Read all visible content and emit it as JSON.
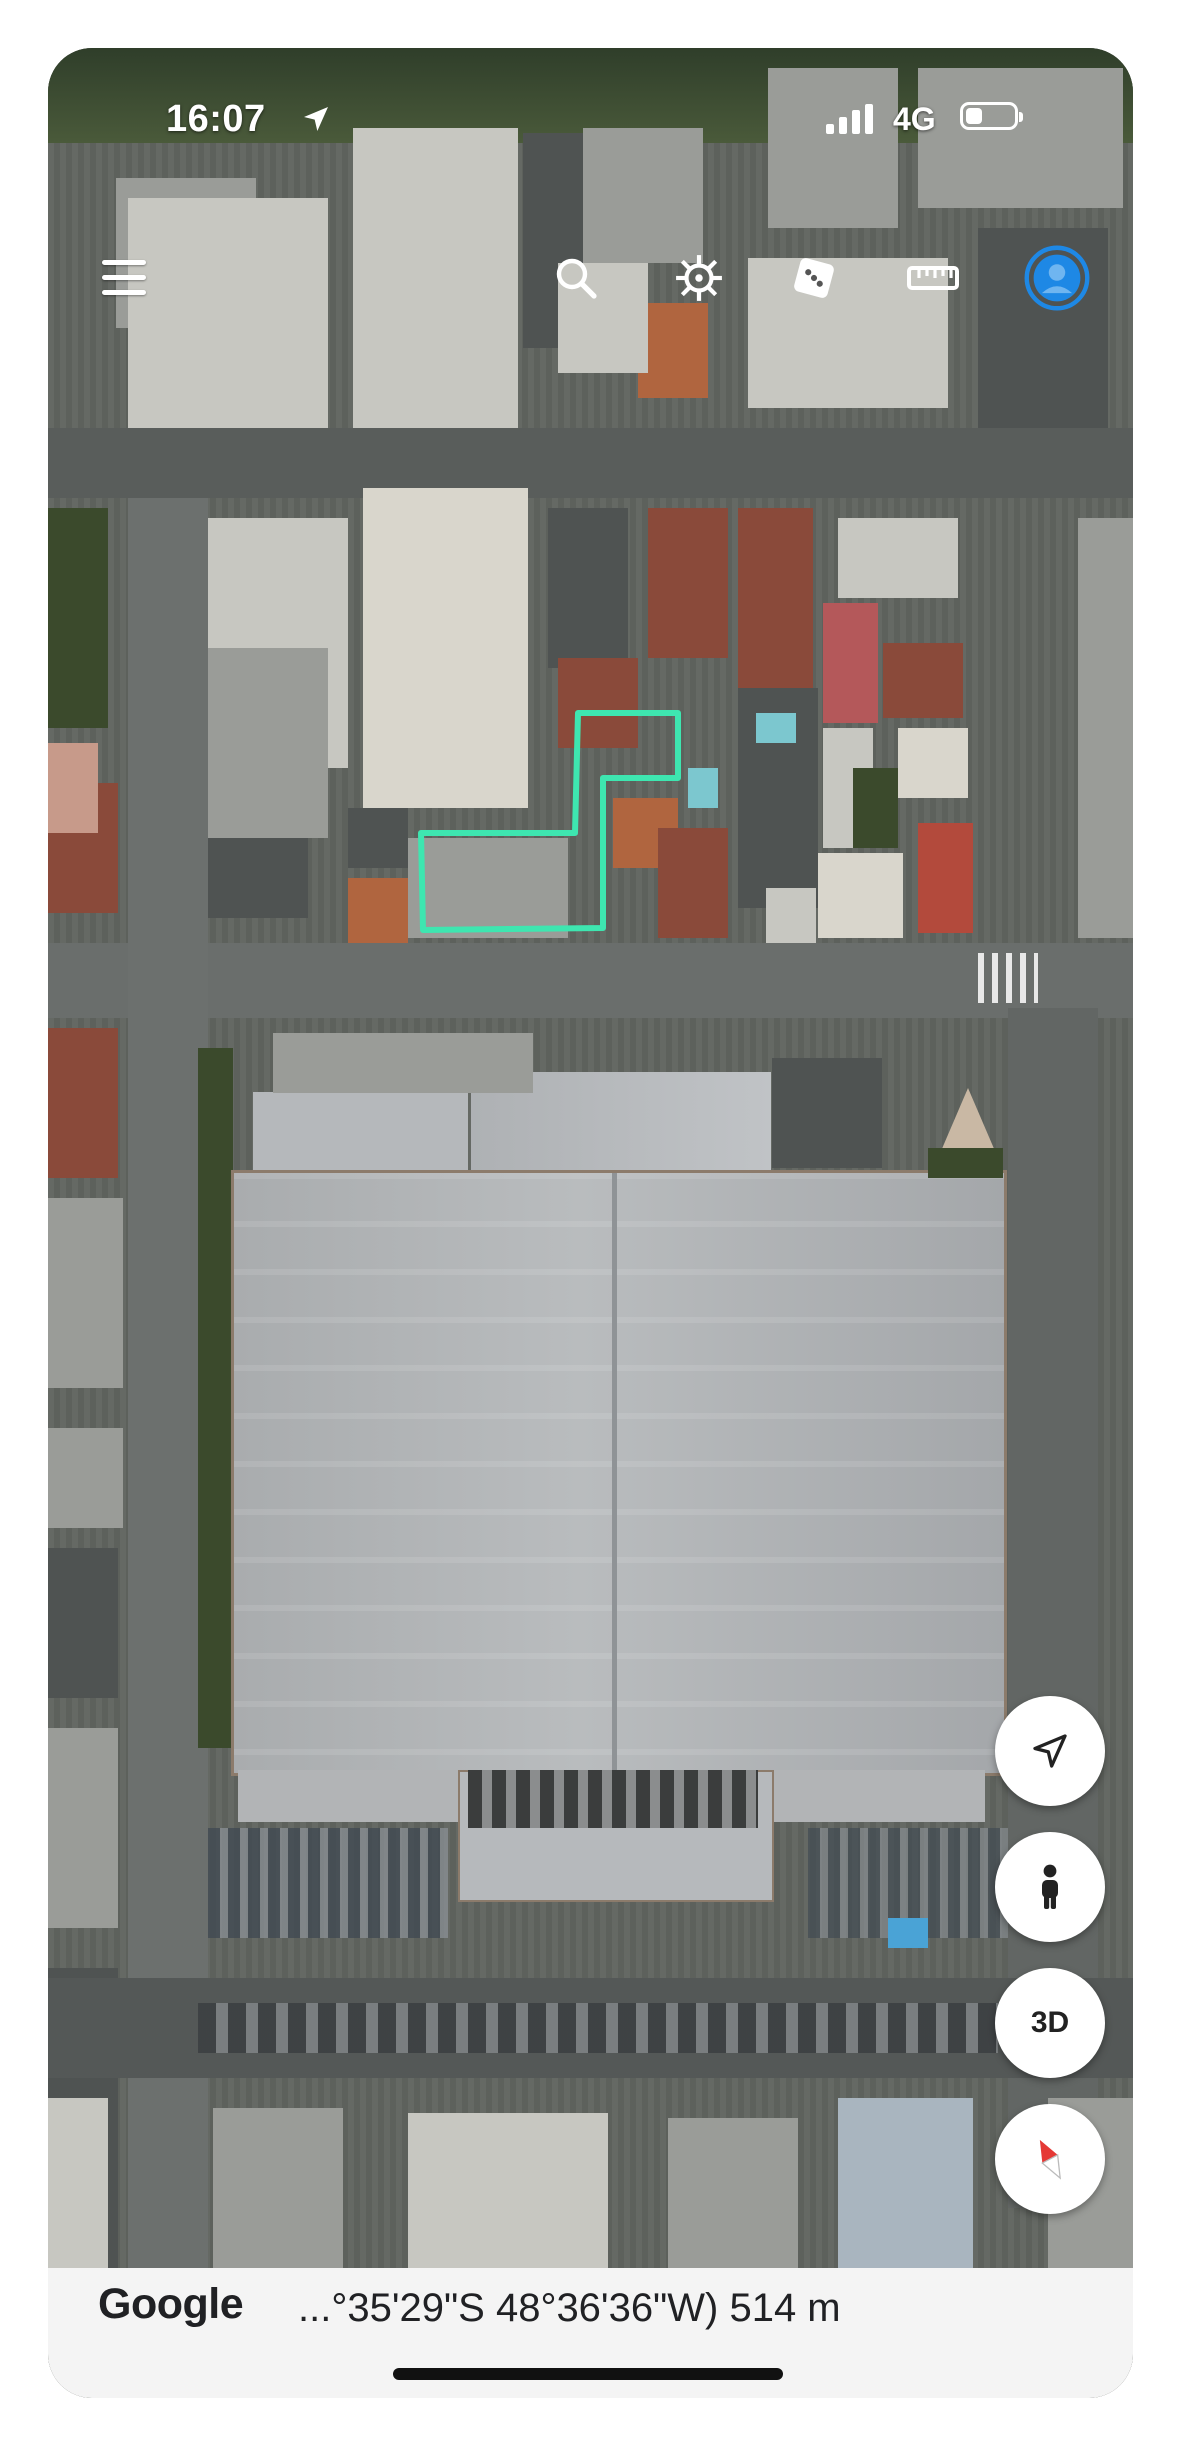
{
  "status_bar": {
    "time": "16:07",
    "network": "4G",
    "signal_bars": 4,
    "battery_level": 0.35,
    "icons": [
      "location-arrow-icon",
      "signal-icon",
      "battery-icon"
    ]
  },
  "toolbar": {
    "icons": [
      "menu-icon",
      "search-icon",
      "voyager-icon",
      "dice-icon",
      "measure-icon",
      "profile-icon"
    ]
  },
  "map_controls": {
    "icons": [
      "my-location-icon",
      "street-view-icon",
      "compass-icon"
    ],
    "three_d_label": "3D"
  },
  "footer": {
    "logo": "Google",
    "coordinates": "...°35'29\"S 48°36'36\"W) 514 m"
  },
  "colors": {
    "parcel_outline": "#3ee6b0",
    "profile_accent": "#1e88e5",
    "compass_red": "#e53935",
    "bottom_bar": "#f4f4f4"
  }
}
